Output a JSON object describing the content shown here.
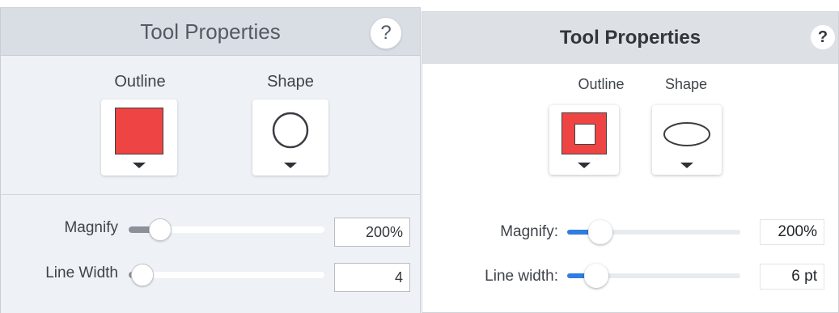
{
  "panels": [
    {
      "title": "Tool Properties",
      "help_label": "?",
      "outline_label": "Outline",
      "shape_label": "Shape",
      "outline_color": "#ef4444",
      "outline_icon": "filled-square-icon",
      "shape_icon": "circle-icon",
      "magnify": {
        "label": "Magnify",
        "value": "200%",
        "level": 0.16
      },
      "line_width": {
        "label": "Line Width",
        "value": "4",
        "level": 0.07
      }
    },
    {
      "title": "Tool Properties",
      "help_label": "?",
      "outline_label": "Outline",
      "shape_label": "Shape",
      "outline_color": "#ef4444",
      "outline_icon": "hollow-square-icon",
      "shape_icon": "ellipse-icon",
      "magnify": {
        "label": "Magnify:",
        "value": "200%",
        "level": 0.19
      },
      "line_width": {
        "label": "Line width:",
        "value": "6 pt",
        "level": 0.17
      }
    }
  ]
}
